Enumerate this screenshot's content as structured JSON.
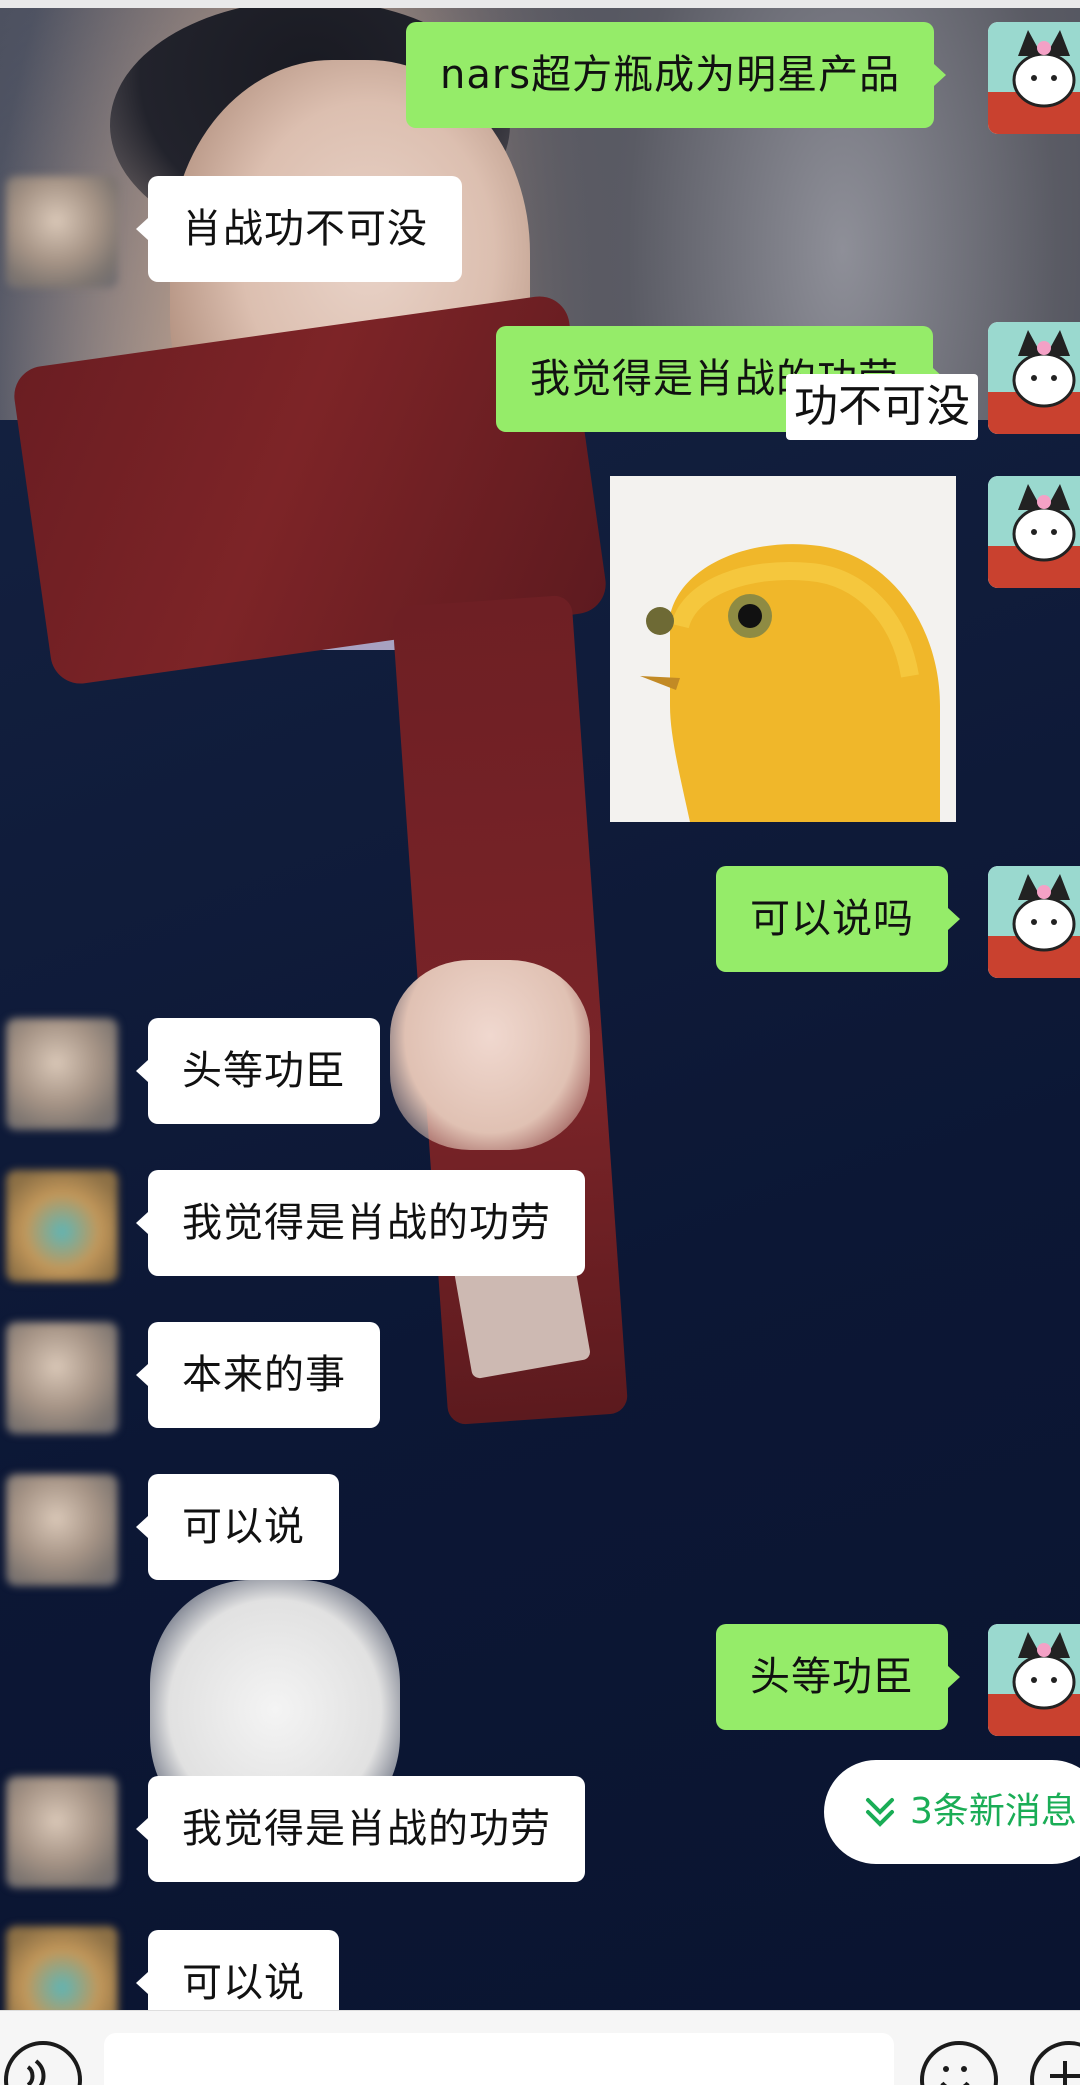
{
  "messages": [
    {
      "side": "out",
      "text": "nars超方瓶成为明星产品"
    },
    {
      "side": "in",
      "text": "肖战功不可没"
    },
    {
      "side": "out",
      "text": "我觉得是肖战的功劳"
    },
    {
      "side": "out",
      "image": "yellow-bird-sticker"
    },
    {
      "side": "out",
      "text": "可以说吗"
    },
    {
      "side": "in",
      "text": "头等功臣"
    },
    {
      "side": "in",
      "text": "我觉得是肖战的功劳"
    },
    {
      "side": "in",
      "text": "本来的事"
    },
    {
      "side": "in",
      "text": "可以说"
    },
    {
      "side": "out",
      "text": "头等功臣"
    },
    {
      "side": "in",
      "text": "我觉得是肖战的功劳"
    },
    {
      "side": "in",
      "text": "可以说"
    }
  ],
  "overlay_text": "功不可没",
  "new_messages_pill": {
    "text": "3条新消息",
    "icon": "double-chevron-down-icon",
    "color": "#1aad56"
  },
  "input_bar": {
    "voice_icon": "voice-icon",
    "emoji_icon": "emoji-icon",
    "plus_icon": "plus-icon"
  },
  "colors": {
    "outgoing_bubble": "#95ec69",
    "incoming_bubble": "#ffffff"
  }
}
